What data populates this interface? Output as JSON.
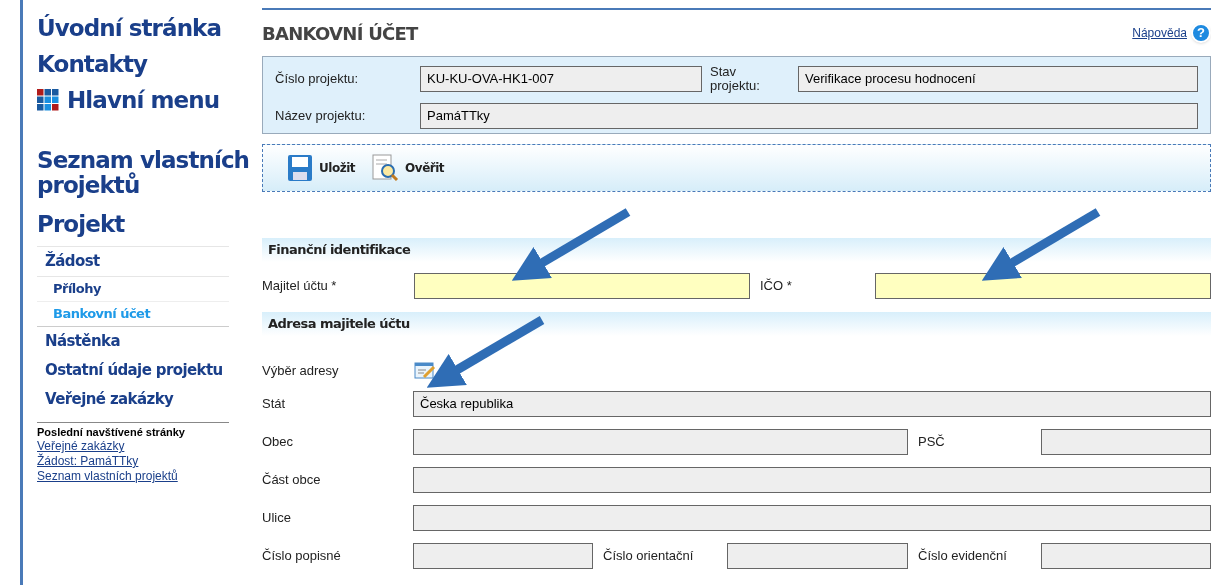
{
  "sidebar": {
    "top_links": [
      {
        "label": "Úvodní stránka",
        "kind": "plain"
      },
      {
        "label": "Kontakty",
        "kind": "plain"
      },
      {
        "label": "Hlavní menu",
        "kind": "grid"
      }
    ],
    "section_links": [
      "Seznam vlastních projektů",
      "Projekt"
    ],
    "menu": [
      {
        "label": "Žádost",
        "selected": false,
        "children": [
          {
            "label": "Přílohy",
            "selected": false
          },
          {
            "label": "Bankovní účet",
            "selected": true
          }
        ]
      },
      {
        "label": "Nástěnka",
        "selected": false
      },
      {
        "label": "Ostatní údaje projektu",
        "selected": false
      },
      {
        "label": "Veřejné zakázky",
        "selected": false
      }
    ],
    "recent": {
      "title": "Poslední navštívené stránky",
      "links": [
        "Veřejné zakázky",
        "Žádost: PamáTTky",
        "Seznam vlastních projektů"
      ]
    }
  },
  "page": {
    "title": "BANKOVNÍ ÚČET",
    "help": "Nápověda",
    "help_icon": "?"
  },
  "project": {
    "number_label": "Číslo projektu:",
    "number": "KU-KU-OVA-HK1-007",
    "state_label": "Stav projektu:",
    "state": "Verifikace procesu hodnocení",
    "name_label": "Název projektu:",
    "name": "PamáTTky"
  },
  "toolbar": [
    {
      "label": "Uložit",
      "kind": "save"
    },
    {
      "label": "Ověřit",
      "kind": "verify"
    }
  ],
  "financial": {
    "title": "Finanční identifikace",
    "owner_label": "Majitel účtu *",
    "ico_label": "IČO *"
  },
  "address": {
    "title": "Adresa majitele účtu",
    "picker_label": "Výběr adresy",
    "country_label": "Stát",
    "country": "Česka republika",
    "city_label": "Obec",
    "zip_label": "PSČ",
    "district_label": "Část obce",
    "street_label": "Ulice",
    "house_label": "Číslo popisné",
    "orient_label": "Číslo orientační",
    "evid_label": "Číslo evidenční"
  }
}
